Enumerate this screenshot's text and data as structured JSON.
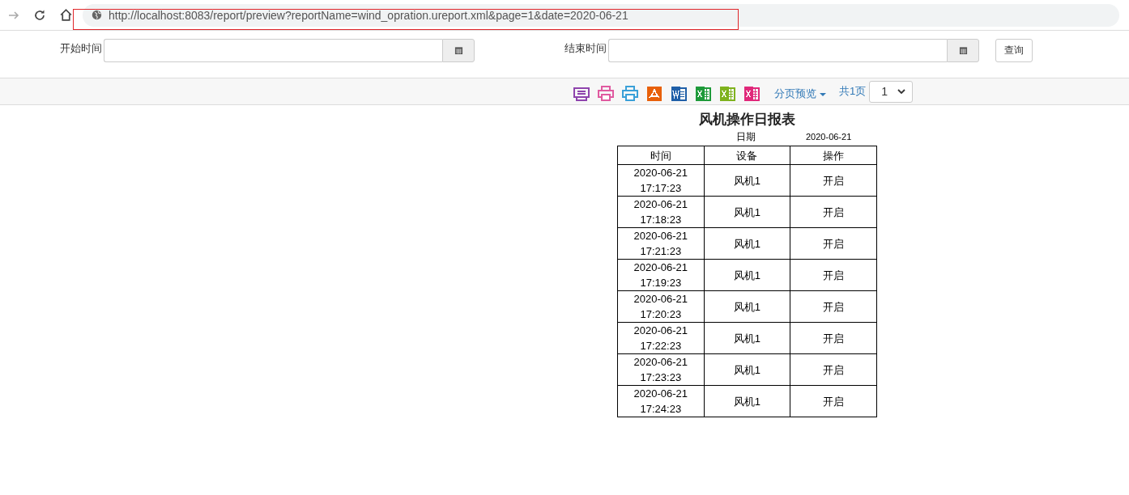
{
  "browser": {
    "url": "http://localhost:8083/report/preview?reportName=wind_opration.ureport.xml&page=1&date=2020-06-21"
  },
  "filters": [
    {
      "label": "开始时间"
    },
    {
      "label": "结束时间"
    }
  ],
  "query_button": "查询",
  "toolbar": {
    "tools": [
      {
        "kind": "print-preview",
        "color": "#8e44ad"
      },
      {
        "kind": "print",
        "color": "#e05aa0"
      },
      {
        "kind": "print",
        "color": "#3aa0d8"
      },
      {
        "kind": "pdf",
        "color": "#e8600a"
      },
      {
        "kind": "word",
        "color": "#1f5fa8"
      },
      {
        "kind": "excel",
        "color": "#1e9a3a"
      },
      {
        "kind": "excel",
        "color": "#7fb21e"
      },
      {
        "kind": "excel",
        "color": "#e0287a"
      }
    ],
    "paging_menu": "分页预览",
    "page_count": "共1页",
    "page_select": "1"
  },
  "report": {
    "title": "风机操作日报表",
    "date_label": "日期",
    "date_value": "2020-06-21",
    "columns": [
      "时间",
      "设备",
      "操作"
    ],
    "rows": [
      [
        "2020-06-21 17:17:23",
        "风机1",
        "开启"
      ],
      [
        "2020-06-21 17:18:23",
        "风机1",
        "开启"
      ],
      [
        "2020-06-21 17:21:23",
        "风机1",
        "开启"
      ],
      [
        "2020-06-21 17:19:23",
        "风机1",
        "开启"
      ],
      [
        "2020-06-21 17:20:23",
        "风机1",
        "开启"
      ],
      [
        "2020-06-21 17:22:23",
        "风机1",
        "开启"
      ],
      [
        "2020-06-21 17:23:23",
        "风机1",
        "开启"
      ],
      [
        "2020-06-21 17:24:23",
        "风机1",
        "开启"
      ]
    ]
  }
}
